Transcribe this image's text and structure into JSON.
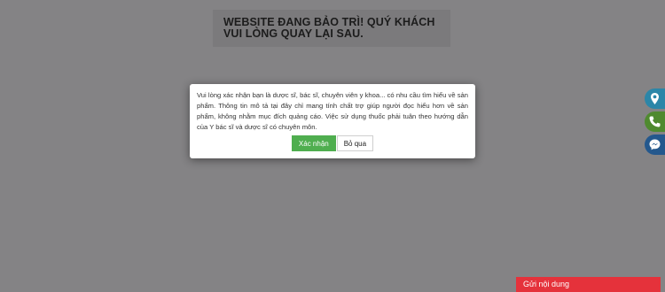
{
  "banner": {
    "text": "WEBSITE ĐANG BẢO TRÌ! QUÝ KHÁCH VUI LÒNG QUAY LẠI SAU."
  },
  "modal": {
    "message": "Vui lòng xác nhận bạn là dược sĩ, bác sĩ, chuyên viên y khoa... có nhu cầu tìm hiểu về sản phẩm. Thông tin mô tả tại đây chỉ mang tính chất trợ giúp người đọc hiểu hơn về sản phẩm, không nhằm mục đích quảng cáo.  Việc sử dụng thuốc phải tuân theo hướng dẫn của Y bác sĩ và dược sĩ có chuyên môn.",
    "confirm_label": "Xác nhận",
    "cancel_label": "Bỏ qua"
  },
  "side_buttons": [
    {
      "icon": "map-pin-icon",
      "color": "#2c86a8"
    },
    {
      "icon": "phone-icon",
      "color": "#4f8a2f"
    },
    {
      "icon": "messenger-icon",
      "color": "#24588d"
    }
  ],
  "send_bar": {
    "label": "Gửi nội dung",
    "color": "#e5323b"
  },
  "colors": {
    "overlay": "#848385",
    "confirm": "#4fae4f"
  }
}
